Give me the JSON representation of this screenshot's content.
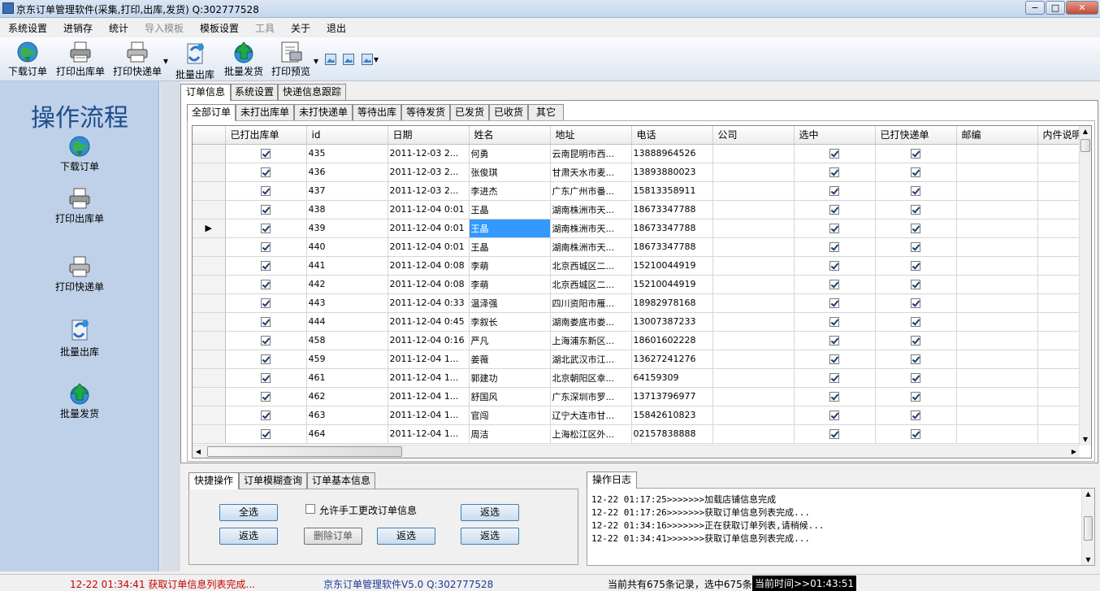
{
  "window": {
    "title": "京东订单管理软件(采集,打印,出库,发货)  Q:302777528",
    "min": "−",
    "max": "□",
    "close": "✕"
  },
  "menu": [
    "系统设置",
    "进销存",
    "统计",
    "导入模板",
    "模板设置",
    "工具",
    "关于",
    "退出"
  ],
  "menu_disabled": [
    3,
    5
  ],
  "toolbar": {
    "buttons": [
      {
        "label": "下载订单",
        "icon": "globe-download-icon"
      },
      {
        "label": "打印出库单",
        "icon": "printer-icon"
      },
      {
        "label": "打印快递单",
        "icon": "printer-icon"
      },
      {
        "label": "批量出库",
        "icon": "batch-out-icon"
      },
      {
        "label": "批量发货",
        "icon": "upload-globe-icon"
      },
      {
        "label": "打印预览",
        "icon": "print-preview-icon"
      }
    ]
  },
  "sidebar": {
    "heading": "操作流程",
    "items": [
      {
        "label": "下载订单",
        "icon": "globe-download-icon"
      },
      {
        "label": "打印出库单",
        "icon": "printer-icon"
      },
      {
        "label": "打印快递单",
        "icon": "printer-icon"
      },
      {
        "label": "批量出库",
        "icon": "batch-out-icon"
      },
      {
        "label": "批量发货",
        "icon": "upload-globe-icon"
      }
    ]
  },
  "main_tabs": [
    "订单信息",
    "系统设置",
    "快递信息跟踪"
  ],
  "order_tabs": [
    "全部订单",
    "未打出库单",
    "未打快递单",
    "等待出库",
    "等待发货",
    "已发货",
    "已收货",
    "其它"
  ],
  "grid": {
    "columns": [
      "已打出库单",
      "id",
      "日期",
      "姓名",
      "地址",
      "电话",
      "公司",
      "选中",
      "已打快递单",
      "邮编",
      "内件说明"
    ],
    "current_row_marker": "▶",
    "rows": [
      {
        "id": "435",
        "date": "2011-12-03 2...",
        "name": "何勇",
        "addr": "云南昆明市西...",
        "phone": "13888964526"
      },
      {
        "id": "436",
        "date": "2011-12-03 2...",
        "name": "张俊琪",
        "addr": "甘肃天水市麦...",
        "phone": "13893880023"
      },
      {
        "id": "437",
        "date": "2011-12-03 2...",
        "name": "李进杰",
        "addr": "广东广州市番...",
        "phone": "15813358911"
      },
      {
        "id": "438",
        "date": "2011-12-04 0:01",
        "name": "王晶",
        "addr": "湖南株洲市天...",
        "phone": "18673347788"
      },
      {
        "id": "439",
        "date": "2011-12-04 0:01",
        "name": "王晶",
        "addr": "湖南株洲市天...",
        "phone": "18673347788"
      },
      {
        "id": "440",
        "date": "2011-12-04 0:01",
        "name": "王晶",
        "addr": "湖南株洲市天...",
        "phone": "18673347788"
      },
      {
        "id": "441",
        "date": "2011-12-04 0:08",
        "name": "李萌",
        "addr": "北京西城区二...",
        "phone": "15210044919"
      },
      {
        "id": "442",
        "date": "2011-12-04 0:08",
        "name": "李萌",
        "addr": "北京西城区二...",
        "phone": "15210044919"
      },
      {
        "id": "443",
        "date": "2011-12-04 0:33",
        "name": "温泽强",
        "addr": "四川资阳市雁...",
        "phone": "18982978168"
      },
      {
        "id": "444",
        "date": "2011-12-04 0:45",
        "name": "李叙长",
        "addr": "湖南娄底市娄...",
        "phone": "13007387233"
      },
      {
        "id": "458",
        "date": "2011-12-04 0:16",
        "name": "严凡",
        "addr": "上海浦东新区...",
        "phone": "18601602228"
      },
      {
        "id": "459",
        "date": "2011-12-04 1...",
        "name": "姜薇",
        "addr": "湖北武汉市江...",
        "phone": "13627241276"
      },
      {
        "id": "461",
        "date": "2011-12-04 1...",
        "name": "郭建功",
        "addr": "北京朝阳区幸...",
        "phone": "64159309"
      },
      {
        "id": "462",
        "date": "2011-12-04 1...",
        "name": "舒国风",
        "addr": "广东深圳市罗...",
        "phone": "13713796977"
      },
      {
        "id": "463",
        "date": "2011-12-04 1...",
        "name": "官闯",
        "addr": "辽宁大连市甘...",
        "phone": "15842610823"
      },
      {
        "id": "464",
        "date": "2011-12-04 1...",
        "name": "周洁",
        "addr": "上海松江区外...",
        "phone": "02157838888"
      }
    ],
    "selected_row": 4
  },
  "bottom_tabs": [
    "快捷操作",
    "订单模糊查询",
    "订单基本信息"
  ],
  "quick": {
    "select_all": "全选",
    "invert1": "返选",
    "allow_manual": "允许手工更改订单信息",
    "delete_order": "删除订单",
    "invert2": "返选",
    "invert3": "返选",
    "invert4": "返选"
  },
  "log": {
    "tab": "操作日志",
    "lines": [
      "12-22 01:17:25>>>>>>>加载店铺信息完成",
      "12-22 01:17:26>>>>>>>获取订单信息列表完成...",
      "12-22 01:34:16>>>>>>>正在获取订单列表,请稍候...",
      "12-22 01:34:41>>>>>>>获取订单信息列表完成..."
    ]
  },
  "status": {
    "message": "12-22 01:34:41 获取订单信息列表完成...",
    "app": "京东订单管理软件V5.0  Q:302777528",
    "records": "当前共有675条记录，选中675条",
    "time": "当前时间>>01:43:51"
  },
  "colors": {
    "accent": "#3399ff",
    "sidebar": "#bfd1e8",
    "heading": "#1e4d8c",
    "status_red": "#cc0000",
    "status_blue": "#1a3a9a"
  }
}
